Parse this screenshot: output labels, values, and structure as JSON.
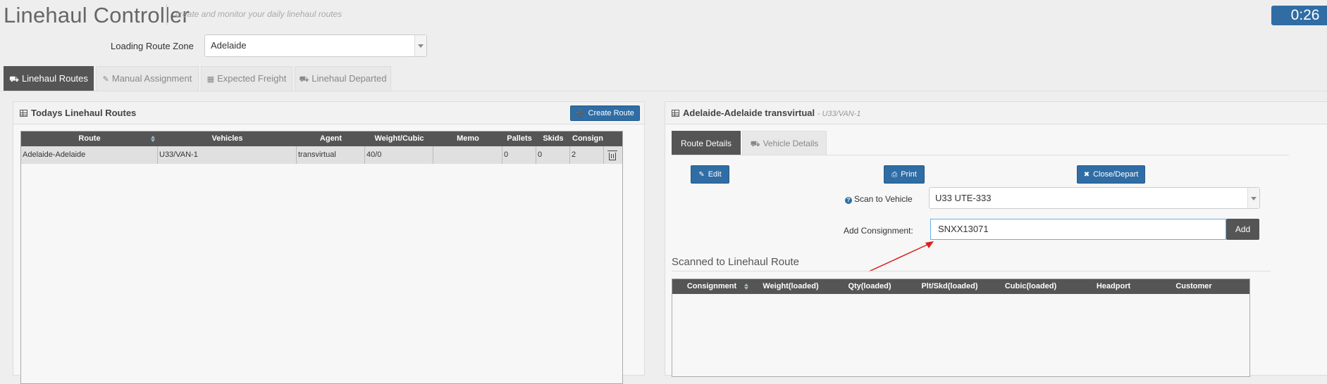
{
  "header": {
    "title": "Linehaul Controller",
    "subtitle": "create and monitor your daily linehaul routes",
    "timer": "0:26"
  },
  "zone": {
    "label": "Loading Route Zone",
    "value": "Adelaide"
  },
  "tabs": [
    {
      "label": "Linehaul Routes",
      "icon": "truck-icon",
      "active": true
    },
    {
      "label": "Manual Assignment",
      "icon": "edit-icon",
      "active": false
    },
    {
      "label": "Expected Freight",
      "icon": "calendar-icon",
      "active": false
    },
    {
      "label": "Linehaul Departed",
      "icon": "truck-icon",
      "active": false
    }
  ],
  "left_panel": {
    "title": "Todays Linehaul Routes",
    "create_button": "Create Route",
    "columns": [
      "Route",
      "Vehicles",
      "Agent",
      "Weight/Cubic",
      "Memo",
      "Pallets",
      "Skids",
      "Consign"
    ],
    "rows": [
      {
        "route": "Adelaide-Adelaide",
        "vehicles": "U33/VAN-1",
        "agent": "transvirtual",
        "weight": "40/0",
        "memo": "",
        "pallets": "0",
        "skids": "0",
        "consign": "2"
      }
    ]
  },
  "right_panel": {
    "title": "Adelaide-Adelaide transvirtual",
    "subtitle": "- U33/VAN-1",
    "tabs": [
      "Route Details",
      "Vehicle Details"
    ],
    "edit_button": "Edit",
    "print_button": "Print",
    "close_button": "Close/Depart",
    "scan_label": "Scan to Vehicle",
    "scan_value": "U33 UTE-333",
    "consignment_label": "Add Consignment:",
    "consignment_value": "SNXX13071",
    "add_button": "Add",
    "scanned_title": "Scanned to Linehaul Route",
    "scanned_columns": [
      "Consignment",
      "Weight(loaded)",
      "Qty(loaded)",
      "Plt/Skd(loaded)",
      "Cubic(loaded)",
      "Headport",
      "Customer"
    ]
  },
  "colors": {
    "primary": "#2f6da4",
    "dark": "#555555",
    "annotation_arrow": "#d9221c"
  }
}
